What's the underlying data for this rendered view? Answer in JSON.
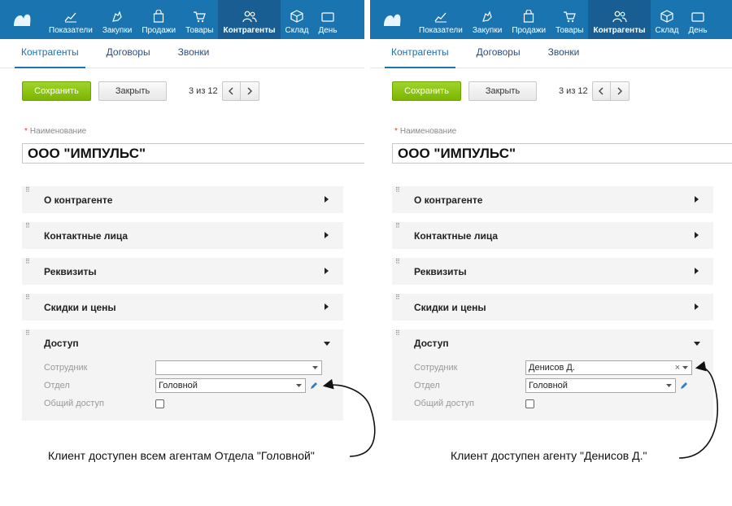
{
  "nav": {
    "items": [
      {
        "label": "Показатели",
        "icon": "chart-icon"
      },
      {
        "label": "Закупки",
        "icon": "hand-icon"
      },
      {
        "label": "Продажи",
        "icon": "bag-icon"
      },
      {
        "label": "Товары",
        "icon": "cart-icon"
      },
      {
        "label": "Контрагенты",
        "icon": "users-icon"
      },
      {
        "label": "Склад",
        "icon": "box-icon"
      },
      {
        "label": "День",
        "icon": "money-icon"
      }
    ]
  },
  "subtabs": [
    "Контрагенты",
    "Договоры",
    "Звонки"
  ],
  "toolbar": {
    "save_label": "Сохранить",
    "close_label": "Закрыть",
    "pager": "3 из 12"
  },
  "form": {
    "name_label": "Наименование",
    "name_required_mark": "*",
    "name_value": "ООО \"ИМПУЛЬС\"",
    "sections": [
      "О контрагенте",
      "Контактные лица",
      "Реквизиты",
      "Скидки и цены",
      "Доступ"
    ],
    "access": {
      "employee_label": "Сотрудник",
      "department_label": "Отдел",
      "shared_label": "Общий доступ",
      "department_value": "Головной"
    }
  },
  "screens": {
    "left": {
      "employee_value": "",
      "caption": "Клиент доступен всем агентам Отдела \"Головной\""
    },
    "right": {
      "employee_value": "Денисов Д.",
      "caption": "Клиент доступен агенту \"Денисов Д.\""
    }
  },
  "colors": {
    "nav": "#1a74b0",
    "nav_active": "#185e92",
    "save": "#8cc411",
    "link": "#1a6fae"
  }
}
